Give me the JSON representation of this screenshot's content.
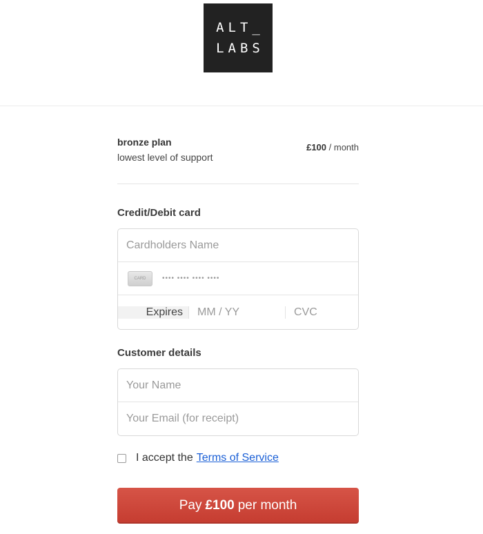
{
  "logo": {
    "line1": "ALT_",
    "line2": "LABS"
  },
  "plan": {
    "name": "bronze plan",
    "description": "lowest level of support",
    "price": "£100",
    "period": "/ month"
  },
  "card_section": {
    "title": "Credit/Debit card",
    "cardholder_placeholder": "Cardholders Name",
    "card_icon_text": "CARD",
    "card_number_placeholder": "•••• •••• •••• ••••",
    "expires_label": "Expires",
    "expiry_placeholder": "MM / YY",
    "cvc_placeholder": "CVC"
  },
  "customer_section": {
    "title": "Customer details",
    "name_placeholder": "Your Name",
    "email_placeholder": "Your Email (for receipt)"
  },
  "terms": {
    "text": "I accept the",
    "link": "Terms of Service",
    "checked": false
  },
  "pay_button": {
    "prefix": "Pay",
    "amount": "£100",
    "suffix": "per month"
  },
  "colors": {
    "button": "#c94236",
    "link": "#1a5fd6",
    "logo_bg": "#222222"
  }
}
